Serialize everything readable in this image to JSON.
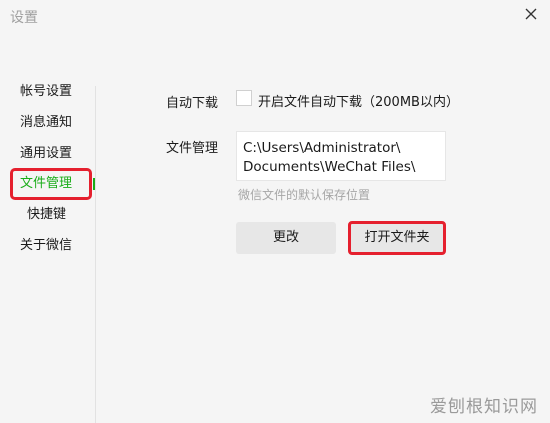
{
  "window": {
    "title": "设置",
    "close_icon": "close-icon"
  },
  "sidebar": {
    "items": [
      {
        "label": "帐号设置"
      },
      {
        "label": "消息通知"
      },
      {
        "label": "通用设置"
      },
      {
        "label": "文件管理",
        "active": true
      },
      {
        "label": "快捷键"
      },
      {
        "label": "关于微信"
      }
    ]
  },
  "main": {
    "auto_download": {
      "label": "自动下载",
      "checkbox_label": "开启文件自动下载（200MB以内）",
      "checked": false
    },
    "file_management": {
      "label": "文件管理",
      "path_line1": "C:\\Users\\Administrator\\",
      "path_line2": "Documents\\WeChat Files\\",
      "hint": "微信文件的默认保存位置"
    },
    "buttons": {
      "change": "更改",
      "open_folder": "打开文件夹"
    }
  },
  "watermark": "爱刨根知识网",
  "colors": {
    "accent": "#1aad19",
    "highlight": "#e5202e",
    "background": "#f5f5f5"
  }
}
